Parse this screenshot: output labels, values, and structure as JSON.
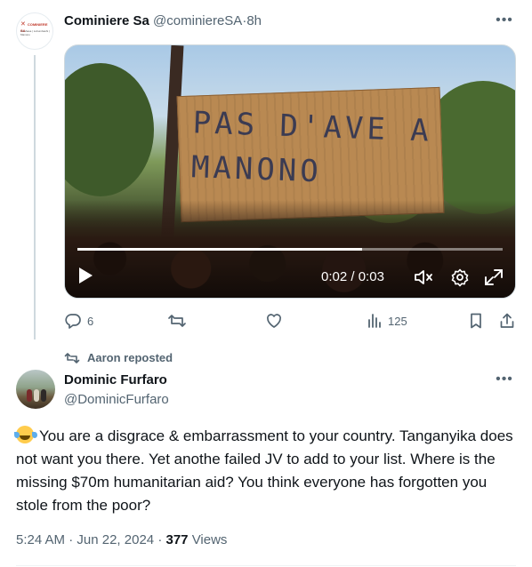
{
  "tweet1": {
    "author_name": "Cominiere Sa",
    "author_handle": "@cominiereSA",
    "separator": "·",
    "time_ago": "8h",
    "avatar": {
      "logo_text": "COMINIERE SA",
      "tagline": "Kinshasa | Lubumbashi | Manono"
    },
    "video": {
      "sign_text": "PAS D'AVE A MANONO",
      "current_time": "0:02",
      "duration": "0:03",
      "time_separator": " / ",
      "progress_fraction": 0.67
    },
    "actions": {
      "reply_count": "6",
      "retweet_count": "",
      "like_count": "",
      "views_count": "125"
    }
  },
  "reposted_by": "Aaron reposted",
  "tweet2": {
    "author_name": "Dominic Furfaro",
    "author_handle": "@DominicFurfaro",
    "text": "You are a disgrace & embarrassment to your country. Tanganyika does not want you there. Yet anothe failed JV to add to your list. Where is the missing $70m humanitarian aid? You think everyone has forgotten you stole from the poor?",
    "time": "5:24 AM",
    "date": "Jun 22, 2024",
    "meta_separator": "·",
    "views_number": "377",
    "views_label": "Views"
  },
  "icons": {
    "more": "more-icon",
    "reply": "reply-icon",
    "retweet": "retweet-icon",
    "like": "like-icon",
    "views": "views-icon",
    "bookmark": "bookmark-icon",
    "share": "share-icon",
    "play": "play-icon",
    "mute": "mute-icon",
    "settings": "settings-icon",
    "fullscreen": "fullscreen-icon"
  },
  "colors": {
    "text": "#0f1419",
    "muted": "#536471",
    "border": "#cfd9de"
  }
}
